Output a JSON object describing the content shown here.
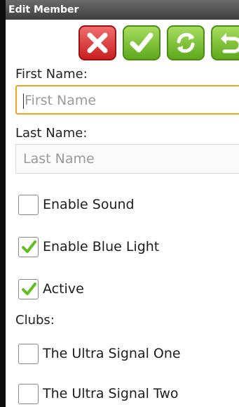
{
  "window": {
    "title": "Edit Member"
  },
  "toolbar": {
    "buttons": [
      {
        "icon": "x-icon",
        "color": "#d62b2b"
      },
      {
        "icon": "checkmark-icon",
        "color": "#6bb325"
      },
      {
        "icon": "refresh-icon",
        "color": "#6bb325"
      },
      {
        "icon": "undo-icon",
        "color": "#6bb325"
      }
    ]
  },
  "form": {
    "first_name": {
      "label": "First Name:",
      "value": "",
      "placeholder": "First Name"
    },
    "last_name": {
      "label": "Last Name:",
      "value": "",
      "placeholder": "Last Name"
    },
    "options": [
      {
        "label": "Enable Sound",
        "checked": false
      },
      {
        "label": "Enable Blue Light",
        "checked": true
      },
      {
        "label": "Active",
        "checked": true
      }
    ],
    "clubs_label": "Clubs:",
    "clubs": [
      {
        "label": "The Ultra Signal One",
        "checked": false
      },
      {
        "label": "The Ultra Signal Two",
        "checked": false
      }
    ]
  },
  "colors": {
    "focus": "#f5a323",
    "check": "#5fbf1e"
  }
}
